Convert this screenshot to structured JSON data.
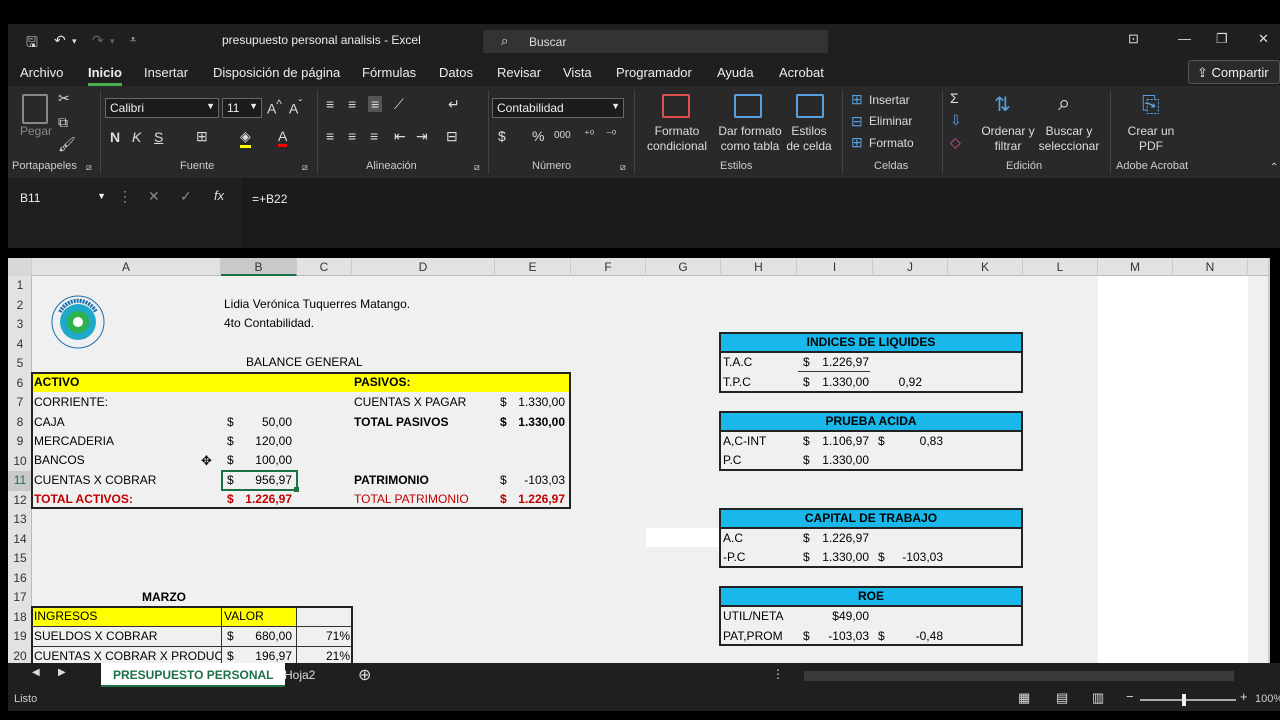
{
  "window": {
    "title": "presupuesto personal analisis  -  Excel",
    "search_placeholder": "Buscar"
  },
  "menu": {
    "tabs": [
      "Archivo",
      "Inicio",
      "Insertar",
      "Disposición de página",
      "Fórmulas",
      "Datos",
      "Revisar",
      "Vista",
      "Programador",
      "Ayuda",
      "Acrobat"
    ],
    "share": "Compartir"
  },
  "ribbon": {
    "clipboard": {
      "paste": "Pegar",
      "group": "Portapapeles"
    },
    "font": {
      "name": "Calibri",
      "size": "11",
      "bold": "N",
      "italic": "K",
      "underline": "S",
      "group": "Fuente"
    },
    "alignment": {
      "group": "Alineación"
    },
    "number": {
      "format": "Contabilidad",
      "currency": "$",
      "percent": "%",
      "thousands": "000",
      "group": "Número"
    },
    "styles": {
      "conditional": "Formato condicional",
      "table": "Dar formato como tabla",
      "cell": "Estilos de celda",
      "group": "Estilos"
    },
    "cells": {
      "insert": "Insertar",
      "delete": "Eliminar",
      "format": "Formato",
      "group": "Celdas"
    },
    "editing": {
      "sort": "Ordenar y filtrar",
      "find": "Buscar y seleccionar",
      "group": "Edición"
    },
    "acrobat": {
      "create": "Crear un PDF",
      "group": "Adobe Acrobat"
    }
  },
  "formula": {
    "cell": "B11",
    "value": "=+B22",
    "fx": "fx"
  },
  "columns": [
    "A",
    "B",
    "C",
    "D",
    "E",
    "F",
    "G",
    "H",
    "I",
    "J",
    "K",
    "L",
    "M",
    "N"
  ],
  "rows": [
    "1",
    "2",
    "3",
    "4",
    "5",
    "6",
    "7",
    "8",
    "9",
    "10",
    "11",
    "12",
    "13",
    "14",
    "15",
    "16",
    "17",
    "18",
    "19",
    "20"
  ],
  "sheet": {
    "header": {
      "name": "Lidia Verónica Tuquerres Matango.",
      "course": "4to Contabilidad.",
      "logo": "TECNOECUATORIANO",
      "logo_sub": "INSTITUTO SUPERIOR TECNOLÓGICO"
    },
    "balance_title": "BALANCE GENERAL",
    "activo": "ACTIVO",
    "corriente": "CORRIENTE:",
    "assets": [
      {
        "label": "CAJA",
        "cur": "$",
        "value": "50,00"
      },
      {
        "label": "MERCADERIA",
        "cur": "$",
        "value": "120,00"
      },
      {
        "label": "BANCOS",
        "cur": "$",
        "value": "100,00"
      },
      {
        "label": "CUENTAS  X COBRAR",
        "cur": "$",
        "value": "956,97"
      }
    ],
    "total_activos": {
      "label": "TOTAL ACTIVOS:",
      "cur": "$",
      "value": "1.226,97"
    },
    "pasivos": "PASIVOS:",
    "cuentas_pagar": {
      "label": "CUENTAS X PAGAR",
      "cur": "$",
      "value": "1.330,00"
    },
    "total_pasivos": {
      "label": "TOTAL PASIVOS",
      "cur": "$",
      "value": "1.330,00"
    },
    "patrimonio": {
      "label": "PATRIMONIO",
      "cur": "$",
      "value": "-103,03"
    },
    "total_patrimonio": {
      "label": "TOTAL PATRIMONIO",
      "cur": "$",
      "value": "1.226,97"
    },
    "marzo": "MARZO",
    "ingresos_head": "INGRESOS",
    "valor_head": "VALOR",
    "ingresos": [
      {
        "label": "SUELDOS X COBRAR",
        "cur": "$",
        "value": "680,00",
        "pct": "71%"
      },
      {
        "label": "CUENTAS X COBRAR X PRODUCTOS",
        "cur": "$",
        "value": "196,97",
        "pct": "21%"
      }
    ],
    "indices": {
      "title": "INDICES DE LIQUIDES",
      "r1": [
        "T.A.C",
        "$",
        "1.226,97",
        ""
      ],
      "r2": [
        "T.P.C",
        "$",
        "1.330,00",
        "0,92"
      ]
    },
    "prueba": {
      "title": "PRUEBA ACIDA",
      "r1": [
        "A,C-INT",
        "$",
        "1.106,97",
        "$",
        "0,83"
      ],
      "r2": [
        "P.C",
        "$",
        "1.330,00"
      ]
    },
    "capital": {
      "title": "CAPITAL DE TRABAJO",
      "r1": [
        "A.C",
        "$",
        "1.226,97"
      ],
      "r2": [
        "-P.C",
        "$",
        "1.330,00",
        "$",
        "-103,03"
      ]
    },
    "roe": {
      "title": "ROE",
      "r1": [
        "UTIL/NETA",
        "$49,00"
      ],
      "r2": [
        "PAT,PROM",
        "$",
        "-103,03",
        "$",
        "-0,48"
      ]
    }
  },
  "tabs": [
    "PRESUPUESTO PERSONAL",
    "Hoja2"
  ],
  "status": {
    "ready": "Listo",
    "zoom": "100%"
  }
}
